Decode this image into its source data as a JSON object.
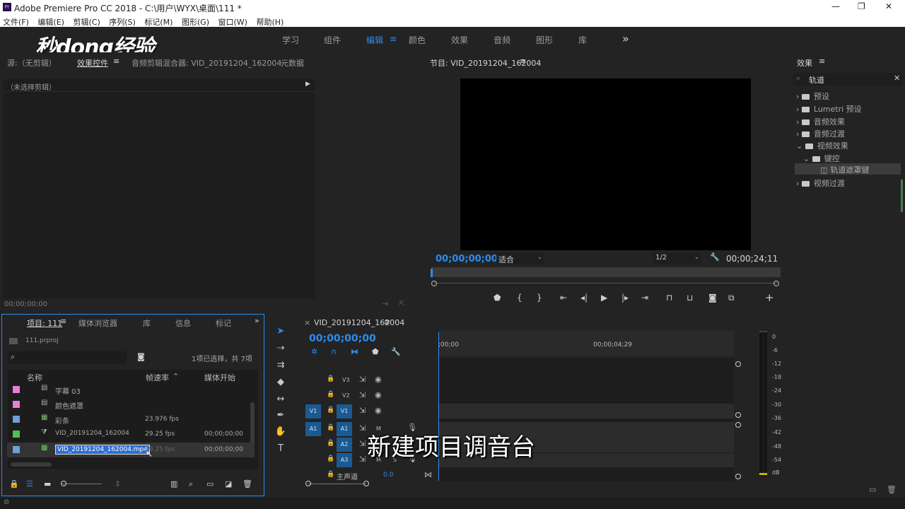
{
  "window": {
    "title": "Adobe Premiere Pro CC 2018 - C:\\用户\\WYX\\桌面\\111 *",
    "controls": [
      "—",
      "❐",
      "✕"
    ]
  },
  "menu": [
    "文件(F)",
    "编辑(E)",
    "剪辑(C)",
    "序列(S)",
    "标记(M)",
    "图形(G)",
    "窗口(W)",
    "帮助(H)"
  ],
  "watermark": "秒dong经验",
  "workspaces": [
    "学习",
    "组件",
    "编辑",
    "颜色",
    "效果",
    "音频",
    "图形",
    "库"
  ],
  "workspace_overflow": "»",
  "source_panel": {
    "tabs": [
      "源:（无剪辑）",
      "效果控件",
      "音频剪辑混合器: VID_20191204_162004",
      "元数据"
    ],
    "no_clip": "（未选择剪辑）",
    "timecode": "00;00;00;00"
  },
  "program_panel": {
    "title": "节目: VID_20191204_162004",
    "timecode": "00;00;00;00",
    "fit": "适合",
    "resolution": "1/2",
    "duration": "00;00;24;11"
  },
  "effects_panel": {
    "title": "效果",
    "search_value": "轨道",
    "items": [
      "预设",
      "Lumetri 预设",
      "音频效果",
      "音频过渡",
      "视频效果",
      "键控",
      "轨道遮罩键",
      "视频过渡"
    ]
  },
  "project_panel": {
    "tabs": [
      "项目: 111",
      "媒体浏览器",
      "库",
      "信息",
      "标记"
    ],
    "file": "111.prproj",
    "selection_info": "1项已选择，共 7项",
    "columns": [
      "名称",
      "帧速率",
      "媒体开始"
    ],
    "rows": [
      {
        "name": "字幕 03",
        "fps": "",
        "start": "",
        "color": "#e87fd4"
      },
      {
        "name": "颜色遮罩",
        "fps": "",
        "start": "",
        "color": "#e87fd4"
      },
      {
        "name": "彩条",
        "fps": "23.976 fps",
        "start": "",
        "color": "#6e9fd8"
      },
      {
        "name": "VID_20191204_162004",
        "fps": "29.25 fps",
        "start": "00;00;00;00",
        "color": "#4fc04f"
      },
      {
        "name": "VID_20191204_162004.mp4",
        "fps": "29.25 fps",
        "start": "00;00;00;00",
        "color": "#6e9fd8"
      }
    ]
  },
  "timeline": {
    "tab": "VID_20191204_162004",
    "timecode": "00;00;00;00",
    "ruler": [
      ";00;00",
      "00;00;04;29"
    ],
    "tracks": [
      {
        "label": "V3"
      },
      {
        "label": "V2"
      },
      {
        "label": "V1",
        "src": "V1"
      },
      {
        "label": "A1",
        "src": "A1"
      },
      {
        "label": "A2"
      },
      {
        "label": "A3"
      }
    ],
    "master": "主声道",
    "master_value": "0.0",
    "m": "M",
    "s": "S"
  },
  "meter_labels": [
    "0",
    "-6",
    "-12",
    "-18",
    "-24",
    "-30",
    "-36",
    "-42",
    "-48",
    "-54",
    "dB"
  ],
  "subtitle": "新建项目调音台"
}
